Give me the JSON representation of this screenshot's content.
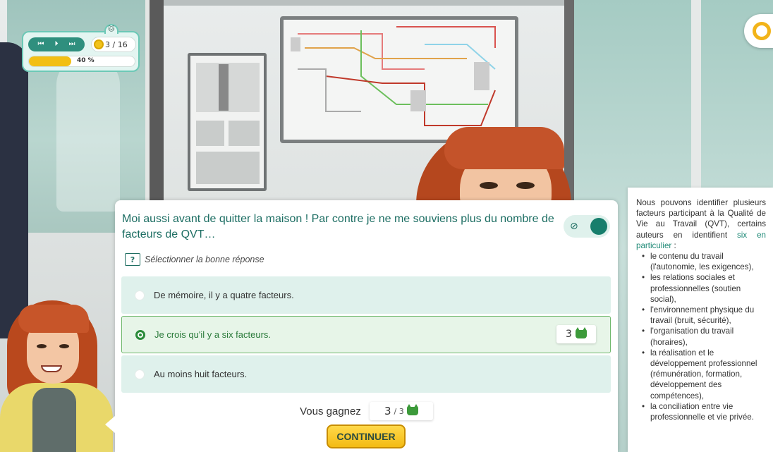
{
  "hud": {
    "controls": [
      "⏮",
      "⏵",
      "⏭"
    ],
    "score_text": "3 / 16",
    "progress_label": "40 %",
    "progress_fraction": 0.4
  },
  "dialog": {
    "question": "Moi aussi avant de quitter la maison ! Par contre je ne me souviens plus du nombre de facteurs de QVT…",
    "instruction_badge": "?",
    "instruction": "Sélectionner la bonne réponse",
    "options": [
      {
        "label": "De mémoire, il y a quatre facteurs.",
        "selected": false
      },
      {
        "label": "Je crois qu'il y a six facteurs.",
        "selected": true,
        "score": "3"
      },
      {
        "label": "Au moins huit facteurs.",
        "selected": false
      }
    ],
    "gain_label": "Vous gagnez",
    "gain_value": "3",
    "gain_total": "/ 3",
    "continue_label": "CONTINUER"
  },
  "info": {
    "intro": "Nous pouvons identifier plusieurs facteurs participant à la Qualité de Vie au Travail (QVT), certains auteurs en identifient",
    "highlight": "six en particulier",
    "after_highlight": " :",
    "factors": [
      "le contenu du travail (l'autonomie, les exigences),",
      "les relations sociales et professionnelles (soutien social),",
      "l'environnement physique du travail (bruit, sécurité),",
      "l'organisation du travail (horaires),",
      "la réalisation et le développement professionnel (rémunération, formation, développement des compétences),",
      "la conciliation entre vie professionnelle et vie privée."
    ]
  },
  "colors": {
    "accent": "#1f8a77",
    "coin": "#f2c21a",
    "selected_border": "#6fb86c",
    "button": "#f3bb14"
  },
  "icons": [
    "rewind-icon",
    "play-icon",
    "skip-icon",
    "coin-icon",
    "cat-icon",
    "eye-off-icon",
    "help-icon"
  ]
}
